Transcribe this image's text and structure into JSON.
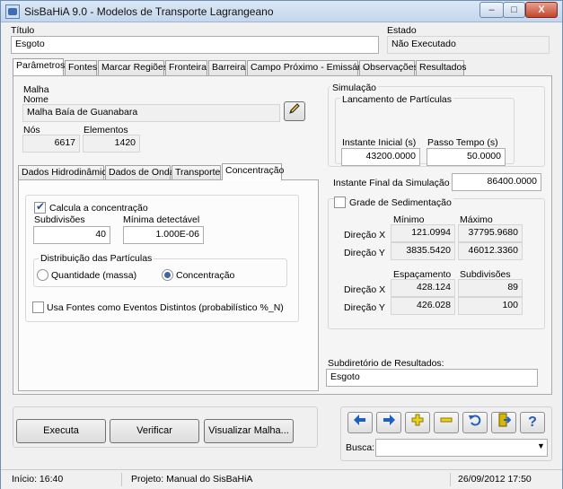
{
  "window": {
    "title": "SisBaHiA 9.0 - Modelos de Transporte Lagrangeano"
  },
  "titlebar_buttons": [
    "–",
    "□",
    "X"
  ],
  "header": {
    "titulo_label": "Título",
    "titulo_value": "Esgoto",
    "estado_label": "Estado",
    "estado_value": "Não Executado"
  },
  "main_tabs": [
    {
      "label": "Parâmetros"
    },
    {
      "label": "Fontes"
    },
    {
      "label": "Marcar Regiões"
    },
    {
      "label": "Fronteira"
    },
    {
      "label": "Barreira"
    },
    {
      "label": "Campo Próximo - Emissários"
    },
    {
      "label": "Observações"
    },
    {
      "label": "Resultados"
    }
  ],
  "malha": {
    "group_label": "Malha",
    "nome_label": "Nome",
    "nome_value": "Malha Baía de Guanabara",
    "nos_label": "Nós",
    "nos_value": "6617",
    "elementos_label": "Elementos",
    "elementos_value": "1420",
    "edit_icon": "pencil-icon"
  },
  "sub_tabs": [
    {
      "label": "Dados Hidrodinâmicos"
    },
    {
      "label": "Dados de Onda"
    },
    {
      "label": "Transporte"
    },
    {
      "label": "Concentração"
    }
  ],
  "concentracao": {
    "calcula_label": "Calcula a concentração",
    "calcula_checked": true,
    "subdivisoes_label": "Subdivisões",
    "subdivisoes_value": "40",
    "minima_label": "Mínima detectável",
    "minima_value": "1.000E-06",
    "distribuicao_label": "Distribuição das Partículas",
    "quantidade_label": "Quantidade (massa)",
    "concentracao_label": "Concentração",
    "selected": "Concentração",
    "usa_fontes_label": "Usa Fontes como Eventos Distintos (probabilístico %_N)",
    "usa_fontes_checked": false
  },
  "simulacao": {
    "group_label": "Simulação",
    "lancamento_label": "Lancamento de Partículas",
    "instante_inicial_label": "Instante Inicial (s)",
    "instante_inicial_value": "43200.0000",
    "passo_tempo_label": "Passo Tempo (s)",
    "passo_tempo_value": "50.0000",
    "instante_final_label": "Instante Final da Simulação (s):",
    "instante_final_value": "86400.0000"
  },
  "grade": {
    "label": "Grade de Sedimentação",
    "checked": false,
    "minimo_label": "Mínimo",
    "maximo_label": "Máximo",
    "direcao_x_label": "Direção X",
    "direcao_y_label": "Direção Y",
    "min_x": "121.0994",
    "max_x": "37795.9680",
    "min_y": "3835.5420",
    "max_y": "46012.3360",
    "espacamento_label": "Espaçamento",
    "subdivisoes_label": "Subdivisões",
    "esp_x": "428.124",
    "sub_x": "89",
    "esp_y": "426.028",
    "sub_y": "100"
  },
  "subdiretorio": {
    "label": "Subdiretório de Resultados:",
    "value": "Esgoto"
  },
  "buttons": {
    "executa": "Executa",
    "verificar": "Verificar",
    "visualizar": "Visualizar Malha..."
  },
  "navigation": {
    "icons": [
      "arrow-left-icon",
      "arrow-right-icon",
      "add-icon",
      "remove-icon",
      "undo-icon",
      "exit-icon",
      "help-icon"
    ],
    "busca_label": "Busca:",
    "busca_value": ""
  },
  "status": {
    "inicio": "Início: 16:40",
    "projeto": "Projeto: Manual do SisBaHiA",
    "datetime": "26/09/2012 17:50"
  },
  "colors": {
    "accent": "#3d63a8",
    "titlebar": "#c3d6ec",
    "nav_blue": "#1e5fc1",
    "nav_yellow": "#d9b600"
  }
}
